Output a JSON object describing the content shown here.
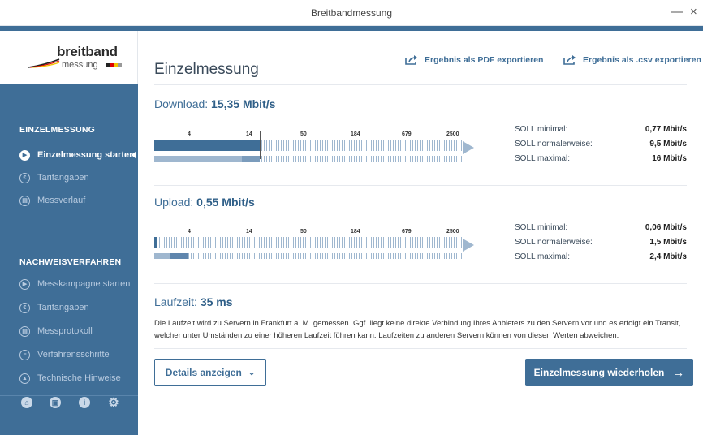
{
  "window": {
    "title": "Breitbandmessung",
    "minimize": "—",
    "close": "×"
  },
  "logo": {
    "brand": "breitband",
    "sub": "messung"
  },
  "sidebar": {
    "section1": "EINZELMESSUNG",
    "items1": [
      {
        "label": "Einzelmessung starten",
        "icon": "play-icon"
      },
      {
        "label": "Tarifangaben",
        "icon": "user-euro-icon"
      },
      {
        "label": "Messverlauf",
        "icon": "history-icon"
      }
    ],
    "section2": "NACHWEISVERFAHREN",
    "items2": [
      {
        "label": "Messkampagne starten",
        "icon": "play-icon"
      },
      {
        "label": "Tarifangaben",
        "icon": "user-euro-icon"
      },
      {
        "label": "Messprotokoll",
        "icon": "protocol-icon"
      },
      {
        "label": "Verfahrensschritte",
        "icon": "list-icon"
      },
      {
        "label": "Technische Hinweise",
        "icon": "warning-icon"
      }
    ],
    "bottom_icons": [
      "home-icon",
      "document-icon",
      "info-icon",
      "settings-icon"
    ]
  },
  "main": {
    "title": "Einzelmessung",
    "export_pdf": "Ergebnis als PDF exportieren",
    "export_csv": "Ergebnis als .csv exportieren",
    "download": {
      "label": "Download: ",
      "value": "15,35 Mbit/s",
      "ticks": [
        "4",
        "14",
        "50",
        "184",
        "679",
        "2500"
      ],
      "soll": [
        {
          "label": "SOLL minimal:",
          "value": "0,77 Mbit/s"
        },
        {
          "label": "SOLL normalerweise:",
          "value": "9,5 Mbit/s"
        },
        {
          "label": "SOLL maximal:",
          "value": "16 Mbit/s"
        }
      ]
    },
    "upload": {
      "label": "Upload: ",
      "value": "0,55 Mbit/s",
      "ticks": [
        "4",
        "14",
        "50",
        "184",
        "679",
        "2500"
      ],
      "soll": [
        {
          "label": "SOLL minimal:",
          "value": "0,06 Mbit/s"
        },
        {
          "label": "SOLL normalerweise:",
          "value": "1,5 Mbit/s"
        },
        {
          "label": "SOLL maximal:",
          "value": "2,4 Mbit/s"
        }
      ]
    },
    "laufzeit": {
      "label": "Laufzeit: ",
      "value": "35 ms",
      "text": "Die Laufzeit wird zu Servern in Frankfurt a. M. gemessen. Ggf. liegt keine direkte Verbindung Ihres Anbieters zu den Servern vor und es erfolgt ein Transit, welcher unter Umständen zu einer höheren Laufzeit führen kann. Laufzeiten zu anderen Servern können von diesen Werten abweichen."
    },
    "details_button": "Details anzeigen",
    "repeat_button": "Einzelmessung wiederholen"
  },
  "colors": {
    "primary": "#3f6e97",
    "bar_light": "#9fb7cf"
  }
}
